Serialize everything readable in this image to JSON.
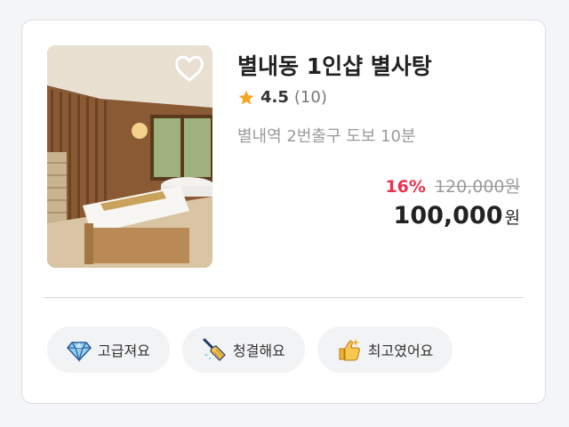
{
  "listing": {
    "title": "별내동 1인샵 별사탕",
    "rating": "4.5",
    "review_count": "(10)",
    "location": "별내역 2번출구 도보 10분",
    "favorited": false
  },
  "price": {
    "discount": "16%",
    "original": "120,000원",
    "final": "100,000",
    "unit": "원"
  },
  "tags": [
    {
      "label": "고급져요",
      "icon": "diamond-icon"
    },
    {
      "label": "청결해요",
      "icon": "broom-icon"
    },
    {
      "label": "최고였어요",
      "icon": "thumbs-up-icon"
    }
  ],
  "colors": {
    "discount": "#e8344e",
    "star": "#f5a623",
    "tag_bg": "#f2f3f5"
  }
}
